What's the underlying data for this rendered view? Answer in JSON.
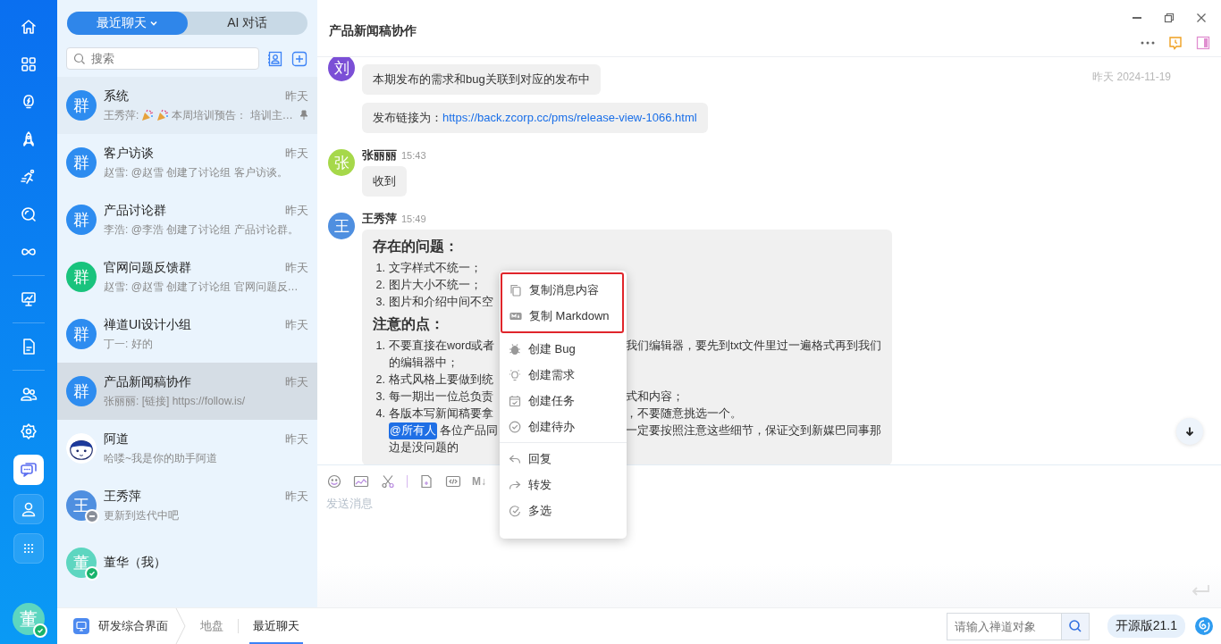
{
  "rail": {
    "items": [
      {
        "kind": "home",
        "selected": false
      },
      {
        "kind": "grid",
        "selected": false
      },
      {
        "kind": "bulb",
        "selected": false
      },
      {
        "kind": "rocket",
        "selected": false
      },
      {
        "kind": "runner",
        "selected": false
      },
      {
        "kind": "search",
        "selected": false
      },
      {
        "kind": "infinity",
        "selected": false
      },
      {
        "kind": "divider"
      },
      {
        "kind": "board",
        "selected": false
      },
      {
        "kind": "divider"
      },
      {
        "kind": "doc",
        "selected": false
      },
      {
        "kind": "divider"
      },
      {
        "kind": "people",
        "selected": false
      },
      {
        "kind": "gear",
        "selected": false
      },
      {
        "kind": "chat",
        "selected": true
      },
      {
        "kind": "user",
        "selected": false
      },
      {
        "kind": "apps",
        "selected": false
      }
    ],
    "avatar": {
      "text": "董",
      "color": "#5dd6c0",
      "online": true
    }
  },
  "sidebar": {
    "tabs": [
      {
        "label": "最近聊天",
        "selected": true,
        "dropdown": true
      },
      {
        "label": "AI 对话",
        "selected": false,
        "dropdown": false
      }
    ],
    "search": {
      "placeholder": "搜索"
    },
    "chats": [
      {
        "kind": "letter",
        "avatar": "群",
        "color": "#2d8cf0",
        "online": false,
        "away": false,
        "name": "系统",
        "time": "昨天",
        "preview": [
          {
            "kind": "text",
            "text": "王秀萍:"
          },
          {
            "kind": "party"
          },
          {
            "kind": "party"
          },
          {
            "kind": "text",
            "text": "本周培训预告： 培训主…"
          }
        ],
        "pinned": true,
        "selected": false
      },
      {
        "kind": "letter",
        "avatar": "群",
        "color": "#2d8cf0",
        "online": false,
        "away": false,
        "name": "客户访谈",
        "time": "昨天",
        "preview": [
          {
            "kind": "text",
            "text": "赵雪: @赵雪 创建了讨论组 客户访谈。"
          }
        ],
        "pinned": false,
        "selected": false
      },
      {
        "kind": "letter",
        "avatar": "群",
        "color": "#2d8cf0",
        "online": false,
        "away": false,
        "name": "产品讨论群",
        "time": "昨天",
        "preview": [
          {
            "kind": "text",
            "text": "李浩: @李浩 创建了讨论组 产品讨论群。"
          }
        ],
        "pinned": false,
        "selected": false
      },
      {
        "kind": "letter",
        "avatar": "群",
        "color": "#19c37d",
        "online": false,
        "away": false,
        "name": "官网问题反馈群",
        "time": "昨天",
        "preview": [
          {
            "kind": "text",
            "text": "赵雪: @赵雪 创建了讨论组 官网问题反…"
          }
        ],
        "pinned": false,
        "selected": false
      },
      {
        "kind": "letter",
        "avatar": "群",
        "color": "#2d8cf0",
        "online": false,
        "away": false,
        "name": "禅道UI设计小组",
        "time": "昨天",
        "preview": [
          {
            "kind": "text",
            "text": "丁一: 好的"
          }
        ],
        "pinned": false,
        "selected": false
      },
      {
        "kind": "letter",
        "avatar": "群",
        "color": "#2d8cf0",
        "online": false,
        "away": false,
        "name": "产品新闻稿协作",
        "time": "昨天",
        "preview": [
          {
            "kind": "text",
            "text": "张丽丽: [链接] https://follow.is/"
          }
        ],
        "pinned": false,
        "selected": true
      },
      {
        "kind": "cartoon",
        "color": "#ffffff",
        "online": false,
        "away": false,
        "name": "阿道",
        "time": "昨天",
        "preview": [
          {
            "kind": "text",
            "text": "哈喽~我是你的助手阿道"
          }
        ],
        "pinned": false,
        "selected": false
      },
      {
        "kind": "letter",
        "avatar": "王",
        "color": "#4f8fe0",
        "online": false,
        "away": true,
        "name": "王秀萍",
        "time": "昨天",
        "preview": [
          {
            "kind": "text",
            "text": "更新到迭代中吧"
          }
        ],
        "pinned": false,
        "selected": false
      },
      {
        "kind": "letter",
        "avatar": "董",
        "color": "#5dd6c0",
        "online": true,
        "away": false,
        "name": "董华（我）",
        "pinned": false,
        "selected": false
      }
    ]
  },
  "chat": {
    "title": "产品新闻稿协作",
    "date_hint": "昨天 2024-11-19",
    "messages": [
      {
        "avatar": "刘",
        "color": "#7b4fd6",
        "bubbles": [
          {
            "kind": "text",
            "parts": [
              {
                "kind": "text",
                "text": "本期发布的需求和bug关联到对应的发布中"
              }
            ]
          },
          {
            "kind": "text",
            "parts": [
              {
                "kind": "text",
                "text": "发布链接为："
              },
              {
                "kind": "link",
                "text": "https://back.zcorp.cc/pms/release-view-1066.html"
              }
            ]
          }
        ]
      },
      {
        "avatar": "张",
        "color": "#a6d84a",
        "name": "张丽丽",
        "time": "15:43",
        "bubbles": [
          {
            "kind": "text",
            "parts": [
              {
                "kind": "text",
                "text": "收到"
              }
            ]
          }
        ]
      },
      {
        "avatar": "王",
        "color": "#4f8fe0",
        "name": "王秀萍",
        "time": "15:49",
        "bubbles": [
          {
            "kind": "doc",
            "blocks": [
              {
                "kind": "heading",
                "text": "存在的问题："
              },
              {
                "kind": "line",
                "number": "1.",
                "left": "文字样式不统一；"
              },
              {
                "kind": "line",
                "number": "2.",
                "left": "图片大小不统一；"
              },
              {
                "kind": "line",
                "number": "3.",
                "left": "图片和介绍中间不空"
              },
              {
                "kind": "heading",
                "text": "注意的点："
              },
              {
                "kind": "line",
                "number": "1.",
                "left": "不要直接在word或者",
                "right": "我们编辑器，要先到txt文件里过一遍格式再到我们"
              },
              {
                "kind": "line",
                "left": "的编辑器中；"
              },
              {
                "kind": "line",
                "number": "2.",
                "left": "格式风格上要做到统"
              },
              {
                "kind": "line",
                "number": "3.",
                "left": "每一期出一位总负责",
                "right": "式和内容；"
              },
              {
                "kind": "line",
                "number": "4.",
                "left": "各版本写新闻稿要拿",
                "right": "，不要随意挑选一个。"
              },
              {
                "kind": "line",
                "mention": "@所有人",
                "left": "各位产品同",
                "right": "一定要按照注意这些细节，保证交到新媒巴同事那"
              },
              {
                "kind": "line",
                "left": "边是没问题的"
              }
            ]
          }
        ]
      }
    ],
    "composer": {
      "tools": [
        {
          "kind": "emoji"
        },
        {
          "kind": "image"
        },
        {
          "kind": "scissors"
        },
        {
          "kind": "sep"
        },
        {
          "kind": "file"
        },
        {
          "kind": "code"
        },
        {
          "kind": "markdown",
          "text": "M↓"
        }
      ],
      "placeholder": "发送消息"
    },
    "context_menu": {
      "groups": [
        {
          "highlighted": true,
          "items": [
            {
              "kind": "copy",
              "label": "复制消息内容"
            },
            {
              "kind": "markdown",
              "label": "复制 Markdown"
            }
          ]
        },
        {
          "highlighted": false,
          "items": [
            {
              "kind": "bug",
              "label": "创建 Bug"
            },
            {
              "kind": "bulb",
              "label": "创建需求"
            },
            {
              "kind": "calendar",
              "label": "创建任务"
            },
            {
              "kind": "check",
              "label": "创建待办"
            }
          ]
        },
        {
          "highlighted": false,
          "items": [
            {
              "kind": "reply",
              "label": "回复"
            },
            {
              "kind": "forward",
              "label": "转发"
            },
            {
              "kind": "multi",
              "label": "多选"
            }
          ]
        }
      ]
    }
  },
  "bottom_bar": {
    "crumbs": [
      {
        "kind": "app",
        "label": "研发综合界面",
        "selected": false
      },
      {
        "kind": "plain",
        "label": "地盘",
        "selected": false
      },
      {
        "kind": "plain",
        "label": "最近聊天",
        "selected": true
      }
    ],
    "search": {
      "placeholder": "请输入禅道对象"
    },
    "version": "开源版21.1"
  }
}
